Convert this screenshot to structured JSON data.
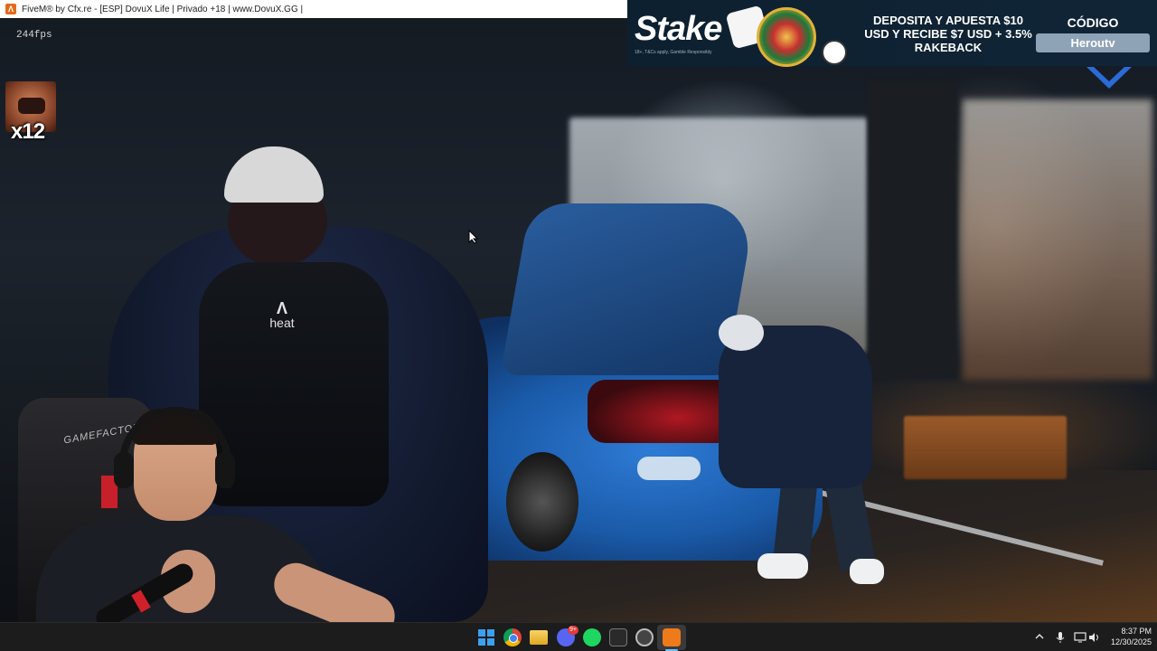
{
  "window": {
    "title": "FiveM® by Cfx.re - [ESP] DovuX Life | Privado +18 | www.DovuX.GG |",
    "icon": "fivem-icon"
  },
  "overlay": {
    "fps": "244fps",
    "emote_count": "x12"
  },
  "ad": {
    "brand": "Stake",
    "disclaimer": "18+, T&Cs apply, Gamble Responsibly",
    "offer_text": "DEPOSITA Y APUESTA $10 USD Y RECIBE $7 USD + 3.5% RAKEBACK",
    "code_label": "CÓDIGO",
    "code_value": "Herоutv"
  },
  "webcam": {
    "chair_brand": "GAMEFACTOR"
  },
  "taskbar": {
    "apps": [
      "windows-start",
      "chrome",
      "file-explorer",
      "discord",
      "spotify",
      "xbox",
      "rockstar-games",
      "fivem"
    ],
    "discord_badge": "9+",
    "time": "8:37 PM",
    "date": "12/30/2025"
  },
  "colors": {
    "taskbar_bg": "#1c1c1c",
    "ad_bg": "#0d2030",
    "ad_code_bg": "#8fa3b6",
    "fivem_orange": "#ef7a1a"
  }
}
